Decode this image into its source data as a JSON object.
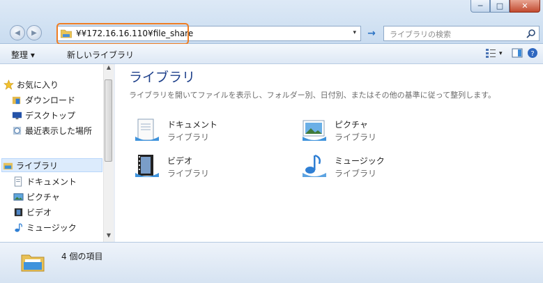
{
  "window": {
    "controls": {
      "minimize": "─",
      "maximize": "□",
      "close": "✕"
    }
  },
  "address": {
    "path": "¥¥172.16.16.110¥file_share",
    "dropdown": "▾",
    "go": "→"
  },
  "search": {
    "placeholder": "ライブラリの検索"
  },
  "toolbar": {
    "organize": "整理 ▾",
    "new_library": "新しいライブラリ",
    "view_dd": "▾"
  },
  "navpane": {
    "favorites": [
      {
        "label": "お気に入り",
        "icon": "star-icon"
      },
      {
        "label": "ダウンロード",
        "icon": "download-folder-icon"
      },
      {
        "label": "デスクトップ",
        "icon": "desktop-icon"
      },
      {
        "label": "最近表示した場所",
        "icon": "recent-places-icon"
      }
    ],
    "libraries": [
      {
        "label": "ライブラリ",
        "icon": "library-icon",
        "selected": true
      },
      {
        "label": "ドキュメント",
        "icon": "document-icon"
      },
      {
        "label": "ピクチャ",
        "icon": "picture-icon"
      },
      {
        "label": "ビデオ",
        "icon": "video-icon"
      },
      {
        "label": "ミュージック",
        "icon": "music-icon"
      }
    ]
  },
  "content": {
    "title": "ライブラリ",
    "description": "ライブラリを開いてファイルを表示し、フォルダー別、日付別、またはその他の基準に従って整列します。",
    "items": [
      {
        "name": "ドキュメント",
        "sub": "ライブラリ",
        "icon": "document-library-icon"
      },
      {
        "name": "ピクチャ",
        "sub": "ライブラリ",
        "icon": "picture-library-icon"
      },
      {
        "name": "ビデオ",
        "sub": "ライブラリ",
        "icon": "video-library-icon"
      },
      {
        "name": "ミュージック",
        "sub": "ライブラリ",
        "icon": "music-library-icon"
      }
    ]
  },
  "status": {
    "text": "4 個の項目"
  },
  "colors": {
    "highlight": "#ef7d22",
    "title_blue": "#1d3f8a",
    "chrome": "#c9dcf0"
  }
}
